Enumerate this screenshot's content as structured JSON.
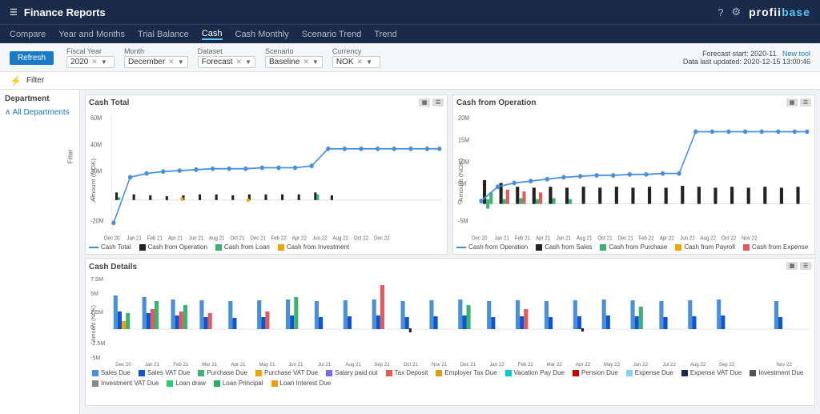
{
  "header": {
    "title": "Finance Reports",
    "logo": "profiitbase"
  },
  "navbar": {
    "items": [
      {
        "label": "Compare",
        "active": false
      },
      {
        "label": "Year and Months",
        "active": false
      },
      {
        "label": "Trial Balance",
        "active": false
      },
      {
        "label": "Cash",
        "active": true
      },
      {
        "label": "Cash Monthly",
        "active": false
      },
      {
        "label": "Scenario Trend",
        "active": false
      },
      {
        "label": "Trend",
        "active": false
      }
    ]
  },
  "toolbar": {
    "refresh_label": "Refresh",
    "fiscal_year_label": "Fiscal Year",
    "fiscal_year_value": "2020",
    "month_label": "Month",
    "month_value": "December",
    "dataset_label": "Dataset",
    "dataset_value": "Forecast",
    "scenario_label": "Scenario",
    "scenario_value": "Baseline",
    "currency_label": "Currency",
    "currency_value": "NOK",
    "forecast_start_label": "Forecast start:",
    "forecast_start_value": "2020-11",
    "data_last_updated_label": "Data last updated:",
    "data_last_updated_value": "2020-12-15 13:00:46",
    "new_tool_label": "New tool"
  },
  "filter": {
    "label": "Filter"
  },
  "sidebar": {
    "title": "Department",
    "items": [
      {
        "label": "∧ All Departments"
      }
    ]
  },
  "chart1": {
    "title": "Cash Total",
    "y_label": "Amount (NOK)",
    "legend": [
      {
        "label": "Cash Total",
        "color": "#4a90d9",
        "type": "line"
      },
      {
        "label": "Cash from Operation",
        "color": "#222",
        "type": "bar"
      },
      {
        "label": "Cash from Loan",
        "color": "#3cb371",
        "type": "bar"
      },
      {
        "label": "Cash from Investment",
        "color": "#f0a500",
        "type": "bar"
      }
    ]
  },
  "chart2": {
    "title": "Cash from Operation",
    "y_label": "Amount (NOK)",
    "legend": [
      {
        "label": "Cash from Operation",
        "color": "#4a90d9",
        "type": "line"
      },
      {
        "label": "Cash from Sales",
        "color": "#222",
        "type": "bar"
      },
      {
        "label": "Cash from Purchase",
        "color": "#3cb371",
        "type": "bar"
      },
      {
        "label": "Cash from Payroll",
        "color": "#f0a500",
        "type": "bar"
      },
      {
        "label": "Cash from Expense",
        "color": "#e05c5c",
        "type": "bar"
      }
    ]
  },
  "chart3": {
    "title": "Cash Details",
    "y_label": "Amount (NOK)",
    "legend": [
      {
        "label": "Sales Due",
        "color": "#4a90d9"
      },
      {
        "label": "Sales VAT Due",
        "color": "#1155cc"
      },
      {
        "label": "Purchase Due",
        "color": "#3cb371"
      },
      {
        "label": "Purchase VAT Due",
        "color": "#f0a500"
      },
      {
        "label": "Salary paid out",
        "color": "#7b68ee"
      },
      {
        "label": "Tax Deposit",
        "color": "#e05c5c"
      },
      {
        "label": "Employer Tax Due",
        "color": "#d4a017"
      },
      {
        "label": "Vacation Pay Due",
        "color": "#00ced1"
      },
      {
        "label": "Pension Due",
        "color": "#cc0000"
      },
      {
        "label": "Expense Due",
        "color": "#87ceeb"
      },
      {
        "label": "Expense VAT Due",
        "color": "#1a2b4a"
      },
      {
        "label": "Investment Due",
        "color": "#555"
      },
      {
        "label": "Investment VAT Due",
        "color": "#888"
      },
      {
        "label": "Loan draw",
        "color": "#2ecc71"
      },
      {
        "label": "Loan Principal",
        "color": "#27ae60"
      },
      {
        "label": "Loan Interest Due",
        "color": "#f39c12"
      }
    ]
  }
}
